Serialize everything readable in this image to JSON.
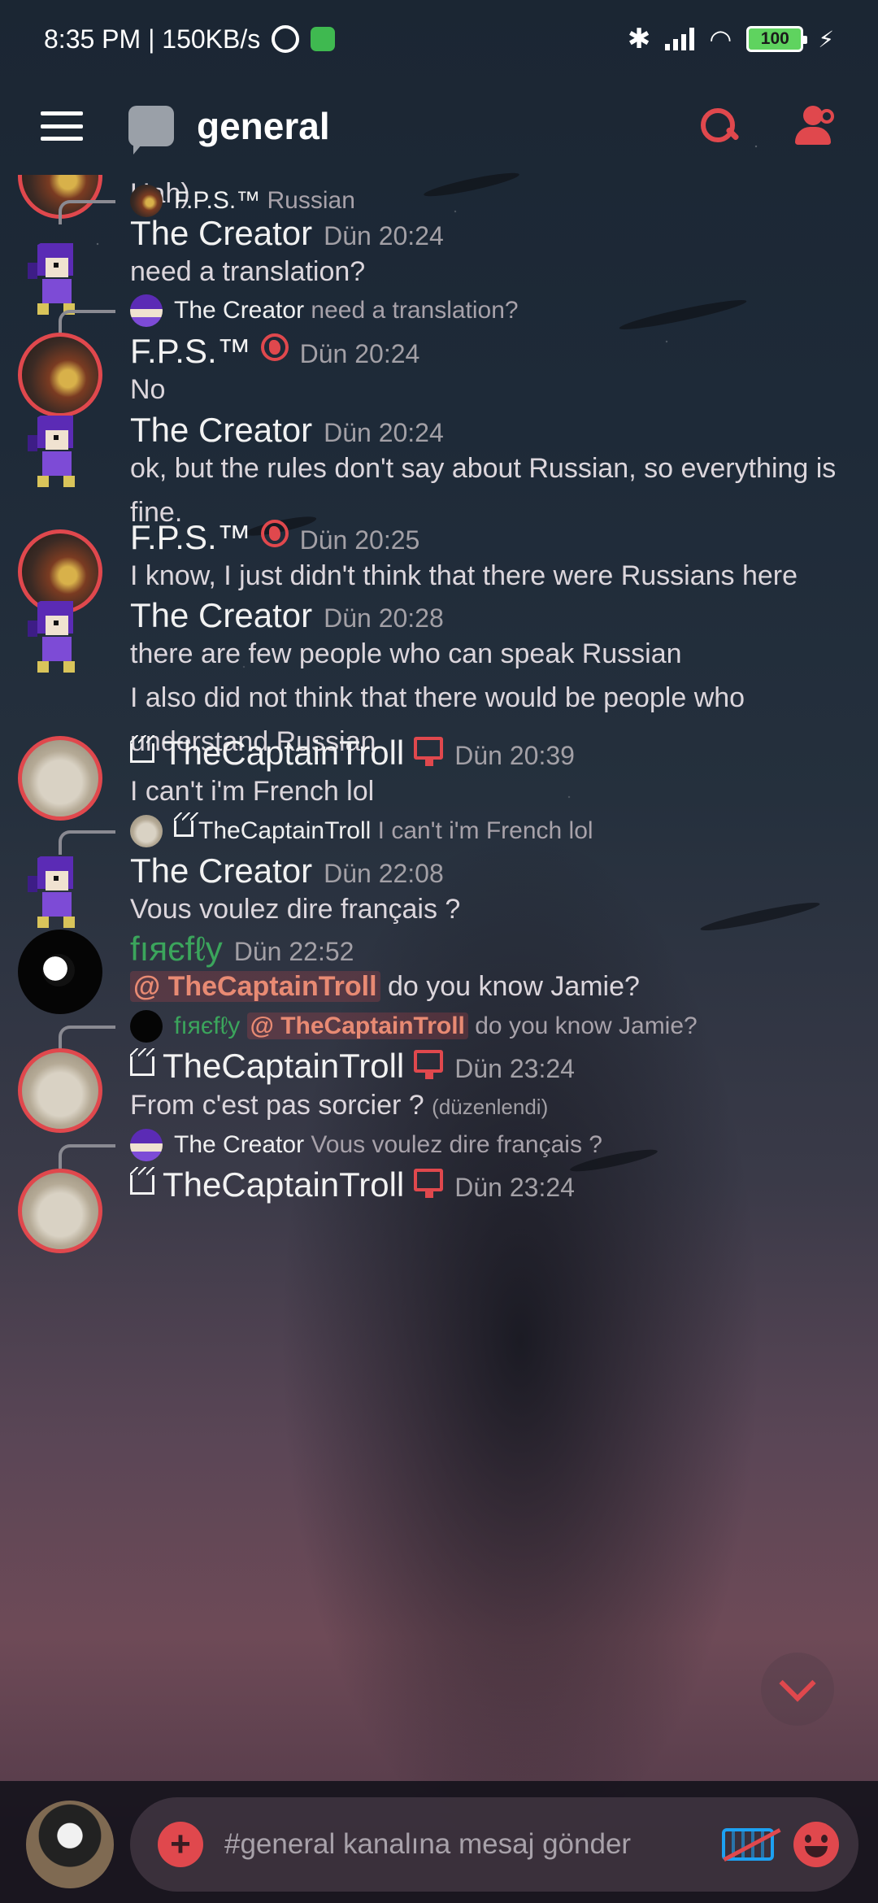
{
  "status_bar": {
    "time_speed": "8:35 PM | 150KB/s",
    "battery": "100"
  },
  "header": {
    "channel_name": "general"
  },
  "messages": [
    {
      "text": "Hah)"
    },
    {
      "reply": {
        "name": "F.P.S.™",
        "text": "Russian"
      },
      "name": "The Creator",
      "time": "Dün 20:24",
      "text": "need a translation?"
    },
    {
      "reply": {
        "name": "The Creator",
        "text": "need a translation?"
      },
      "name": "F.P.S.™",
      "time": "Dün 20:24",
      "text": "No"
    },
    {
      "name": "The Creator",
      "time": "Dün 20:24",
      "text": "ok, but the rules don't say about Russian, so everything is fine."
    },
    {
      "name": "F.P.S.™",
      "time": "Dün 20:25",
      "text": "I know, I just didn't think that there were Russians here"
    },
    {
      "name": "The Creator",
      "time": "Dün 20:28",
      "text_lines": [
        "there are few people who can speak Russian",
        "I also did not think that there would be people who understand Russian"
      ]
    },
    {
      "name": "TheCaptainTroll",
      "time": "Dün 20:39",
      "text": "I can't i'm French lol"
    },
    {
      "reply": {
        "name": "TheCaptainTroll",
        "text": "I can't i'm French lol"
      },
      "name": "The Creator",
      "time": "Dün 22:08",
      "text": "Vous voulez dire français ?"
    },
    {
      "name": "fıяєfℓy",
      "time": "Dün 22:52",
      "mention": "@ TheCaptainTroll",
      "text": "do you know Jamie?"
    },
    {
      "reply": {
        "name": "fıяєfℓy",
        "mention": "@ TheCaptainTroll",
        "text": "do you know Jamie?"
      },
      "name": "TheCaptainTroll",
      "time": "Dün 23:24",
      "text": "From c'est pas sorcier ?",
      "edited": "(düzenlendi)"
    },
    {
      "reply": {
        "name": "The Creator",
        "text": "Vous voulez dire français ?"
      },
      "name": "TheCaptainTroll",
      "time": "Dün 23:24"
    }
  ],
  "composer": {
    "placeholder": "#general kanalına mesaj gönder",
    "plus": "+"
  },
  "colors": {
    "accent": "#e0484d",
    "firefly_green": "#3ba55c",
    "keyboard_blue": "#1da1f2"
  },
  "icons": [
    "hamburger-icon",
    "channel-chat-icon",
    "search-icon",
    "members-icon",
    "globe-icon",
    "monitor-icon",
    "crown-icon",
    "chevron-down-icon",
    "plus-icon",
    "keyboard-off-icon",
    "emoji-icon"
  ]
}
